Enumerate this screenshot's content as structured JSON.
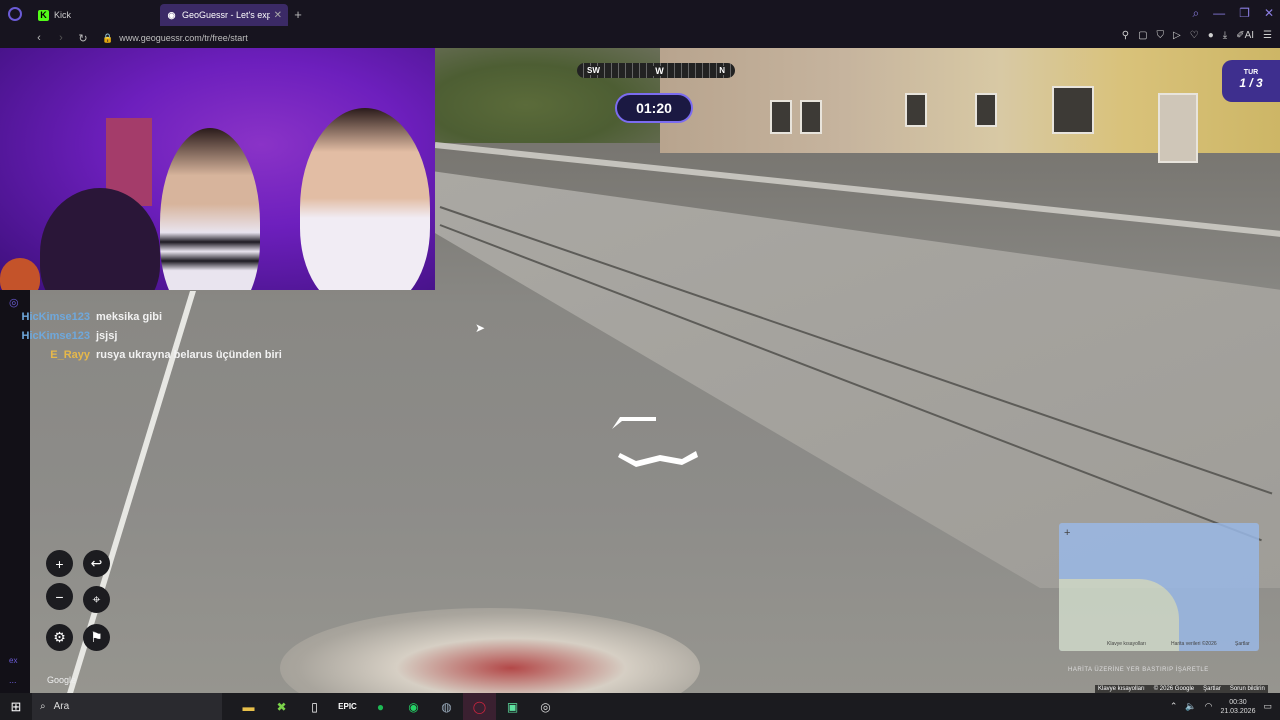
{
  "browser": {
    "tabs": [
      {
        "label": "Kick",
        "favicon": "kick-icon",
        "active": false
      },
      {
        "label": "GeoGuessr - Let's exp",
        "favicon": "geoguessr-icon",
        "active": true
      }
    ],
    "new_tab": "+",
    "url": "www.geoguessr.com/tr/free/start",
    "ai_label": "AI",
    "window_controls": [
      "search-icon",
      "minimize-icon",
      "maximize-icon",
      "close-icon"
    ]
  },
  "game": {
    "compass": {
      "left": "SW",
      "center": "W",
      "right": "N"
    },
    "timer": "01:20",
    "round": {
      "label": "TUR",
      "value": "1 / 3"
    },
    "google_label": "Google"
  },
  "chat": [
    {
      "user": "HicKimse123",
      "message": "meksika gibi",
      "color": "#6fa8dc"
    },
    {
      "user": "HicKimse123",
      "message": "jsjsj",
      "color": "#6fa8dc"
    },
    {
      "user": "E_Rayy",
      "message": "rusya ukrayna belarus üçünden biri",
      "color": "#e6b84a"
    }
  ],
  "minimap": {
    "hint": "HARİTA ÜZERİNE YER BASTIRIP İŞARETLE",
    "attribution": [
      "Klavye kısayolları",
      "© 2026 Google",
      "Şartlar",
      "Sorun bildirin"
    ],
    "small_labels": [
      "Klavye kısayolları",
      "Harita verileri ©2026",
      "Şartlar"
    ]
  },
  "sidebar": {
    "badge": "ex",
    "more": "..."
  },
  "taskbar": {
    "search_label": "Ara",
    "time": "00:30",
    "date": "21.03.2026",
    "apps": [
      "file-explorer-icon",
      "xbox-icon",
      "notepad-icon",
      "epic-games-icon",
      "spotify-icon",
      "whatsapp-icon",
      "steam-icon",
      "opera-gx-icon",
      "discord-icon",
      "obs-icon"
    ]
  },
  "colors": {
    "accent": "#7b6cf0",
    "kick_green": "#53fc18",
    "webcam_purple": "#6d1fbd"
  }
}
